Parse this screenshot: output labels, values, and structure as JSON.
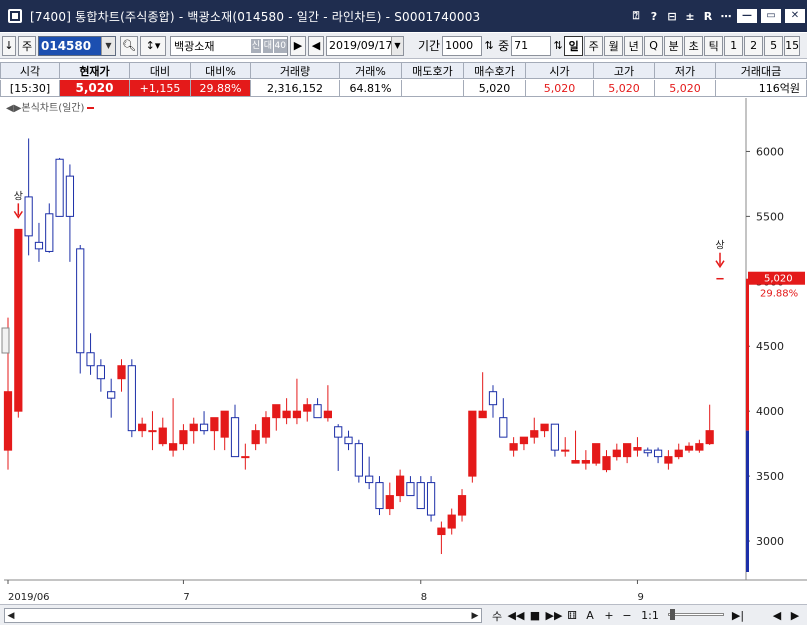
{
  "window": {
    "title": "[7400] 통합차트(주식종합) - 백광소재(014580 - 일간 - 라인차트) - S0001740003",
    "tools": [
      "⍰",
      "?",
      "⊟",
      "±",
      "R",
      "⋯"
    ],
    "min": "—",
    "max": "▭",
    "close": "✕"
  },
  "toolbar": {
    "lock": "↓",
    "market": "주",
    "code": "014580",
    "name": "백광소재",
    "badges": [
      "신",
      "대",
      "40"
    ],
    "date": "2019/09/17",
    "period_label": "기간",
    "period_value": "1000",
    "mid_label": "중",
    "mid_value": "71",
    "periods": [
      "일",
      "주",
      "월",
      "년",
      "Q",
      "분",
      "초",
      "틱",
      "1",
      "2",
      "5",
      "15"
    ],
    "active_period": "일"
  },
  "quote": {
    "headers": [
      "시각",
      "현재가",
      "대비",
      "대비%",
      "거래량",
      "거래%",
      "매도호가",
      "매수호가",
      "시가",
      "고가",
      "저가",
      "거래대금"
    ],
    "values": [
      "[15:30]",
      "5,020",
      "+1,155",
      "29.88%",
      "2,316,152",
      "64.81%",
      "",
      "5,020",
      "5,020",
      "5,020",
      "5,020",
      "116억원"
    ]
  },
  "chart_label": "본식차트(일간)",
  "chart_data": {
    "type": "candlestick",
    "title": "",
    "ylim": [
      2700,
      6350
    ],
    "y_ticks": [
      3000,
      3500,
      4000,
      4500,
      5000,
      5500,
      6000
    ],
    "x_labels": [
      {
        "index": 0,
        "label": "2019/06"
      },
      {
        "index": 17,
        "label": "7"
      },
      {
        "index": 40,
        "label": "8"
      },
      {
        "index": 61,
        "label": "9"
      }
    ],
    "candles": [
      {
        "o": 3700,
        "h": 4720,
        "l": 3550,
        "c": 4150
      },
      {
        "o": 4000,
        "h": 5400,
        "l": 3950,
        "c": 5400
      },
      {
        "o": 5650,
        "h": 6100,
        "l": 5200,
        "c": 5350
      },
      {
        "o": 5300,
        "h": 5450,
        "l": 5150,
        "c": 5250
      },
      {
        "o": 5520,
        "h": 5600,
        "l": 5220,
        "c": 5230
      },
      {
        "o": 5940,
        "h": 5950,
        "l": 5500,
        "c": 5500
      },
      {
        "o": 5810,
        "h": 5900,
        "l": 5150,
        "c": 5500
      },
      {
        "o": 5250,
        "h": 5280,
        "l": 4290,
        "c": 4450
      },
      {
        "o": 4450,
        "h": 4600,
        "l": 4280,
        "c": 4350
      },
      {
        "o": 4350,
        "h": 4400,
        "l": 4150,
        "c": 4250
      },
      {
        "o": 4150,
        "h": 4250,
        "l": 3950,
        "c": 4100
      },
      {
        "o": 4250,
        "h": 4400,
        "l": 4150,
        "c": 4350
      },
      {
        "o": 4350,
        "h": 4400,
        "l": 3800,
        "c": 3850
      },
      {
        "o": 3850,
        "h": 3950,
        "l": 3800,
        "c": 3900
      },
      {
        "o": 3850,
        "h": 4000,
        "l": 3700,
        "c": 3850
      },
      {
        "o": 3750,
        "h": 3950,
        "l": 3730,
        "c": 3870
      },
      {
        "o": 3700,
        "h": 4100,
        "l": 3650,
        "c": 3750
      },
      {
        "o": 3750,
        "h": 3900,
        "l": 3700,
        "c": 3850
      },
      {
        "o": 3850,
        "h": 3950,
        "l": 3750,
        "c": 3900
      },
      {
        "o": 3900,
        "h": 4000,
        "l": 3820,
        "c": 3850
      },
      {
        "o": 3850,
        "h": 3950,
        "l": 3700,
        "c": 3950
      },
      {
        "o": 3800,
        "h": 4000,
        "l": 3700,
        "c": 4000
      },
      {
        "o": 3950,
        "h": 4050,
        "l": 3650,
        "c": 3650
      },
      {
        "o": 3650,
        "h": 3750,
        "l": 3550,
        "c": 3650
      },
      {
        "o": 3750,
        "h": 3900,
        "l": 3700,
        "c": 3850
      },
      {
        "o": 3800,
        "h": 4000,
        "l": 3750,
        "c": 3950
      },
      {
        "o": 3950,
        "h": 4050,
        "l": 3850,
        "c": 4050
      },
      {
        "o": 3950,
        "h": 4100,
        "l": 3900,
        "c": 4000
      },
      {
        "o": 3950,
        "h": 4250,
        "l": 3900,
        "c": 4000
      },
      {
        "o": 4000,
        "h": 4100,
        "l": 3920,
        "c": 4050
      },
      {
        "o": 4050,
        "h": 4100,
        "l": 3950,
        "c": 3950
      },
      {
        "o": 3950,
        "h": 4200,
        "l": 3920,
        "c": 4000
      },
      {
        "o": 3880,
        "h": 3900,
        "l": 3540,
        "c": 3800
      },
      {
        "o": 3800,
        "h": 3850,
        "l": 3700,
        "c": 3750
      },
      {
        "o": 3750,
        "h": 3780,
        "l": 3450,
        "c": 3500
      },
      {
        "o": 3500,
        "h": 3650,
        "l": 3400,
        "c": 3450
      },
      {
        "o": 3450,
        "h": 3500,
        "l": 3200,
        "c": 3250
      },
      {
        "o": 3250,
        "h": 3450,
        "l": 3200,
        "c": 3350
      },
      {
        "o": 3350,
        "h": 3550,
        "l": 3300,
        "c": 3500
      },
      {
        "o": 3450,
        "h": 3500,
        "l": 3350,
        "c": 3350
      },
      {
        "o": 3450,
        "h": 3500,
        "l": 3250,
        "c": 3250
      },
      {
        "o": 3450,
        "h": 3500,
        "l": 3150,
        "c": 3200
      },
      {
        "o": 3050,
        "h": 3150,
        "l": 2900,
        "c": 3100
      },
      {
        "o": 3100,
        "h": 3250,
        "l": 3050,
        "c": 3200
      },
      {
        "o": 3200,
        "h": 3400,
        "l": 3150,
        "c": 3350
      },
      {
        "o": 3500,
        "h": 4000,
        "l": 3450,
        "c": 4000
      },
      {
        "o": 3950,
        "h": 4300,
        "l": 3950,
        "c": 4000
      },
      {
        "o": 4150,
        "h": 4200,
        "l": 3950,
        "c": 4050
      },
      {
        "o": 3950,
        "h": 4100,
        "l": 3800,
        "c": 3800
      },
      {
        "o": 3700,
        "h": 3800,
        "l": 3650,
        "c": 3750
      },
      {
        "o": 3750,
        "h": 3800,
        "l": 3700,
        "c": 3800
      },
      {
        "o": 3800,
        "h": 3950,
        "l": 3750,
        "c": 3850
      },
      {
        "o": 3850,
        "h": 3900,
        "l": 3800,
        "c": 3900
      },
      {
        "o": 3900,
        "h": 3900,
        "l": 3650,
        "c": 3700
      },
      {
        "o": 3700,
        "h": 3800,
        "l": 3650,
        "c": 3700
      },
      {
        "o": 3600,
        "h": 3850,
        "l": 3600,
        "c": 3620
      },
      {
        "o": 3600,
        "h": 3700,
        "l": 3550,
        "c": 3620
      },
      {
        "o": 3600,
        "h": 3750,
        "l": 3580,
        "c": 3750
      },
      {
        "o": 3550,
        "h": 3700,
        "l": 3530,
        "c": 3650
      },
      {
        "o": 3650,
        "h": 3750,
        "l": 3620,
        "c": 3700
      },
      {
        "o": 3650,
        "h": 3750,
        "l": 3600,
        "c": 3750
      },
      {
        "o": 3700,
        "h": 3800,
        "l": 3650,
        "c": 3720
      },
      {
        "o": 3700,
        "h": 3720,
        "l": 3650,
        "c": 3680
      },
      {
        "o": 3700,
        "h": 3720,
        "l": 3600,
        "c": 3650
      },
      {
        "o": 3600,
        "h": 3700,
        "l": 3550,
        "c": 3650
      },
      {
        "o": 3650,
        "h": 3750,
        "l": 3630,
        "c": 3700
      },
      {
        "o": 3700,
        "h": 3760,
        "l": 3680,
        "c": 3730
      },
      {
        "o": 3700,
        "h": 3780,
        "l": 3680,
        "c": 3750
      },
      {
        "o": 3750,
        "h": 4050,
        "l": 3740,
        "c": 3850
      },
      {
        "o": 5020,
        "h": 5020,
        "l": 5020,
        "c": 5020
      }
    ],
    "markers": [
      {
        "index": 1,
        "text": "상"
      },
      {
        "index": 69,
        "text": "상"
      }
    ],
    "last_price_label": "5,020",
    "last_pct_label": "29.88%",
    "colors": {
      "up": "#e41a1a",
      "down": "#1c2fa8",
      "up_body": "#e41a1a",
      "down_body": "#ffffff"
    }
  },
  "bottom": {
    "tools": [
      "수",
      "◀◀",
      "■",
      "▶▶",
      "⚅",
      "A",
      "+",
      "−",
      "1:1",
      "▶|",
      "◀",
      "▶"
    ]
  }
}
